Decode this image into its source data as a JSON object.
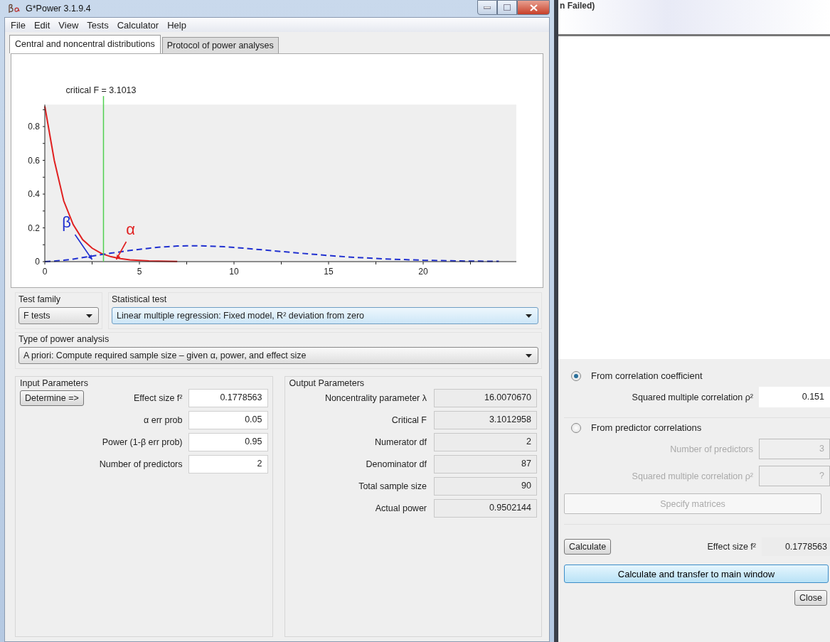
{
  "background_window": {
    "title": "n Failed)"
  },
  "window": {
    "title": "G*Power 3.1.9.4"
  },
  "menu": [
    "File",
    "Edit",
    "View",
    "Tests",
    "Calculator",
    "Help"
  ],
  "tabs": [
    {
      "label": "Central and noncentral distributions",
      "selected": true
    },
    {
      "label": "Protocol of power analyses",
      "selected": false
    }
  ],
  "chart_data": {
    "type": "line",
    "x": [
      0,
      0.5,
      1,
      1.5,
      2,
      2.5,
      3,
      3.5,
      4,
      4.5,
      5,
      5.5,
      6,
      6.5,
      7,
      7.5,
      8,
      8.5,
      9,
      9.5,
      10,
      10.5,
      11,
      11.5,
      12,
      12.5,
      13,
      13.5,
      14,
      14.5,
      15,
      15.5,
      16,
      16.5,
      17,
      17.5,
      18,
      18.5,
      19,
      19.5,
      20,
      20.5,
      21,
      21.5,
      22,
      22.5,
      23,
      23.5,
      24
    ],
    "series": [
      {
        "color": "#e02020",
        "line_style": "solid",
        "values": [
          0.92,
          0.6,
          0.36,
          0.22,
          0.13,
          0.08,
          0.048,
          0.029,
          0.018,
          0.011,
          0.007,
          0.004,
          0.003,
          0.002,
          0.001,
          null,
          null,
          null,
          null,
          null,
          null,
          null,
          null,
          null,
          null,
          null,
          null,
          null,
          null,
          null,
          null,
          null,
          null,
          null,
          null,
          null,
          null,
          null,
          null,
          null,
          null,
          null,
          null,
          null,
          null,
          null,
          null,
          null,
          null
        ]
      },
      {
        "color": "#2030d0",
        "line_style": "dashed",
        "values": [
          0,
          0.003,
          0.008,
          0.015,
          0.024,
          0.033,
          0.042,
          0.05,
          0.058,
          0.066,
          0.073,
          0.079,
          0.085,
          0.089,
          0.092,
          0.094,
          0.094,
          0.093,
          0.091,
          0.088,
          0.084,
          0.08,
          0.075,
          0.07,
          0.065,
          0.06,
          0.055,
          0.05,
          0.045,
          0.041,
          0.036,
          0.032,
          0.028,
          0.025,
          0.022,
          0.019,
          0.016,
          0.014,
          0.012,
          0.01,
          0.008,
          0.007,
          0.006,
          0.005,
          0.004,
          0.003,
          0.003,
          0.002,
          0.002
        ]
      }
    ],
    "xlim": [
      0,
      25
    ],
    "ylim": [
      0,
      0.93
    ],
    "xticks": [
      0,
      5,
      10,
      15,
      20
    ],
    "yticks": [
      0,
      0.2,
      0.4,
      0.6,
      0.8
    ],
    "ref_lines": [
      {
        "axis": "x",
        "value": 3.1013,
        "label": "critical F = 3.1013",
        "color": "#50d050"
      }
    ],
    "annotations": [
      "β",
      "α"
    ]
  },
  "test_family": {
    "label": "Test family",
    "value": "F tests"
  },
  "statistical_test": {
    "label": "Statistical test",
    "value": "Linear multiple regression: Fixed model, R² deviation from zero"
  },
  "power_analysis_type": {
    "label": "Type of power analysis",
    "value": "A priori: Compute required sample size – given α, power, and effect size"
  },
  "input_parameters": {
    "title": "Input Parameters",
    "button": "Determine =>",
    "fields": [
      {
        "label": "Effect size f²",
        "value": "0.1778563"
      },
      {
        "label": "α err prob",
        "value": "0.05"
      },
      {
        "label": "Power (1-β err prob)",
        "value": "0.95"
      },
      {
        "label": "Number of predictors",
        "value": "2"
      }
    ]
  },
  "output_parameters": {
    "title": "Output Parameters",
    "fields": [
      {
        "label": "Noncentrality parameter λ",
        "value": "16.0070670"
      },
      {
        "label": "Critical F",
        "value": "3.1012958"
      },
      {
        "label": "Numerator df",
        "value": "2"
      },
      {
        "label": "Denominator df",
        "value": "87"
      },
      {
        "label": "Total sample size",
        "value": "90"
      },
      {
        "label": "Actual power",
        "value": "0.9502144"
      }
    ]
  },
  "effect_size_panel": {
    "options": [
      {
        "label": "From correlation coefficient",
        "selected": true,
        "fields": [
          {
            "label": "Squared multiple correlation ρ²",
            "value": "0.151"
          }
        ]
      },
      {
        "label": "From predictor correlations",
        "selected": false,
        "fields": [
          {
            "label": "Number of predictors",
            "value": "3"
          },
          {
            "label": "Squared multiple correlation ρ²",
            "value": "?"
          }
        ],
        "button": "Specify matrices"
      }
    ],
    "calculate_button": "Calculate",
    "effect_size": {
      "label": "Effect size f²",
      "value": "0.1778563"
    },
    "transfer_button": "Calculate and transfer to main window",
    "close_button": "Close"
  }
}
